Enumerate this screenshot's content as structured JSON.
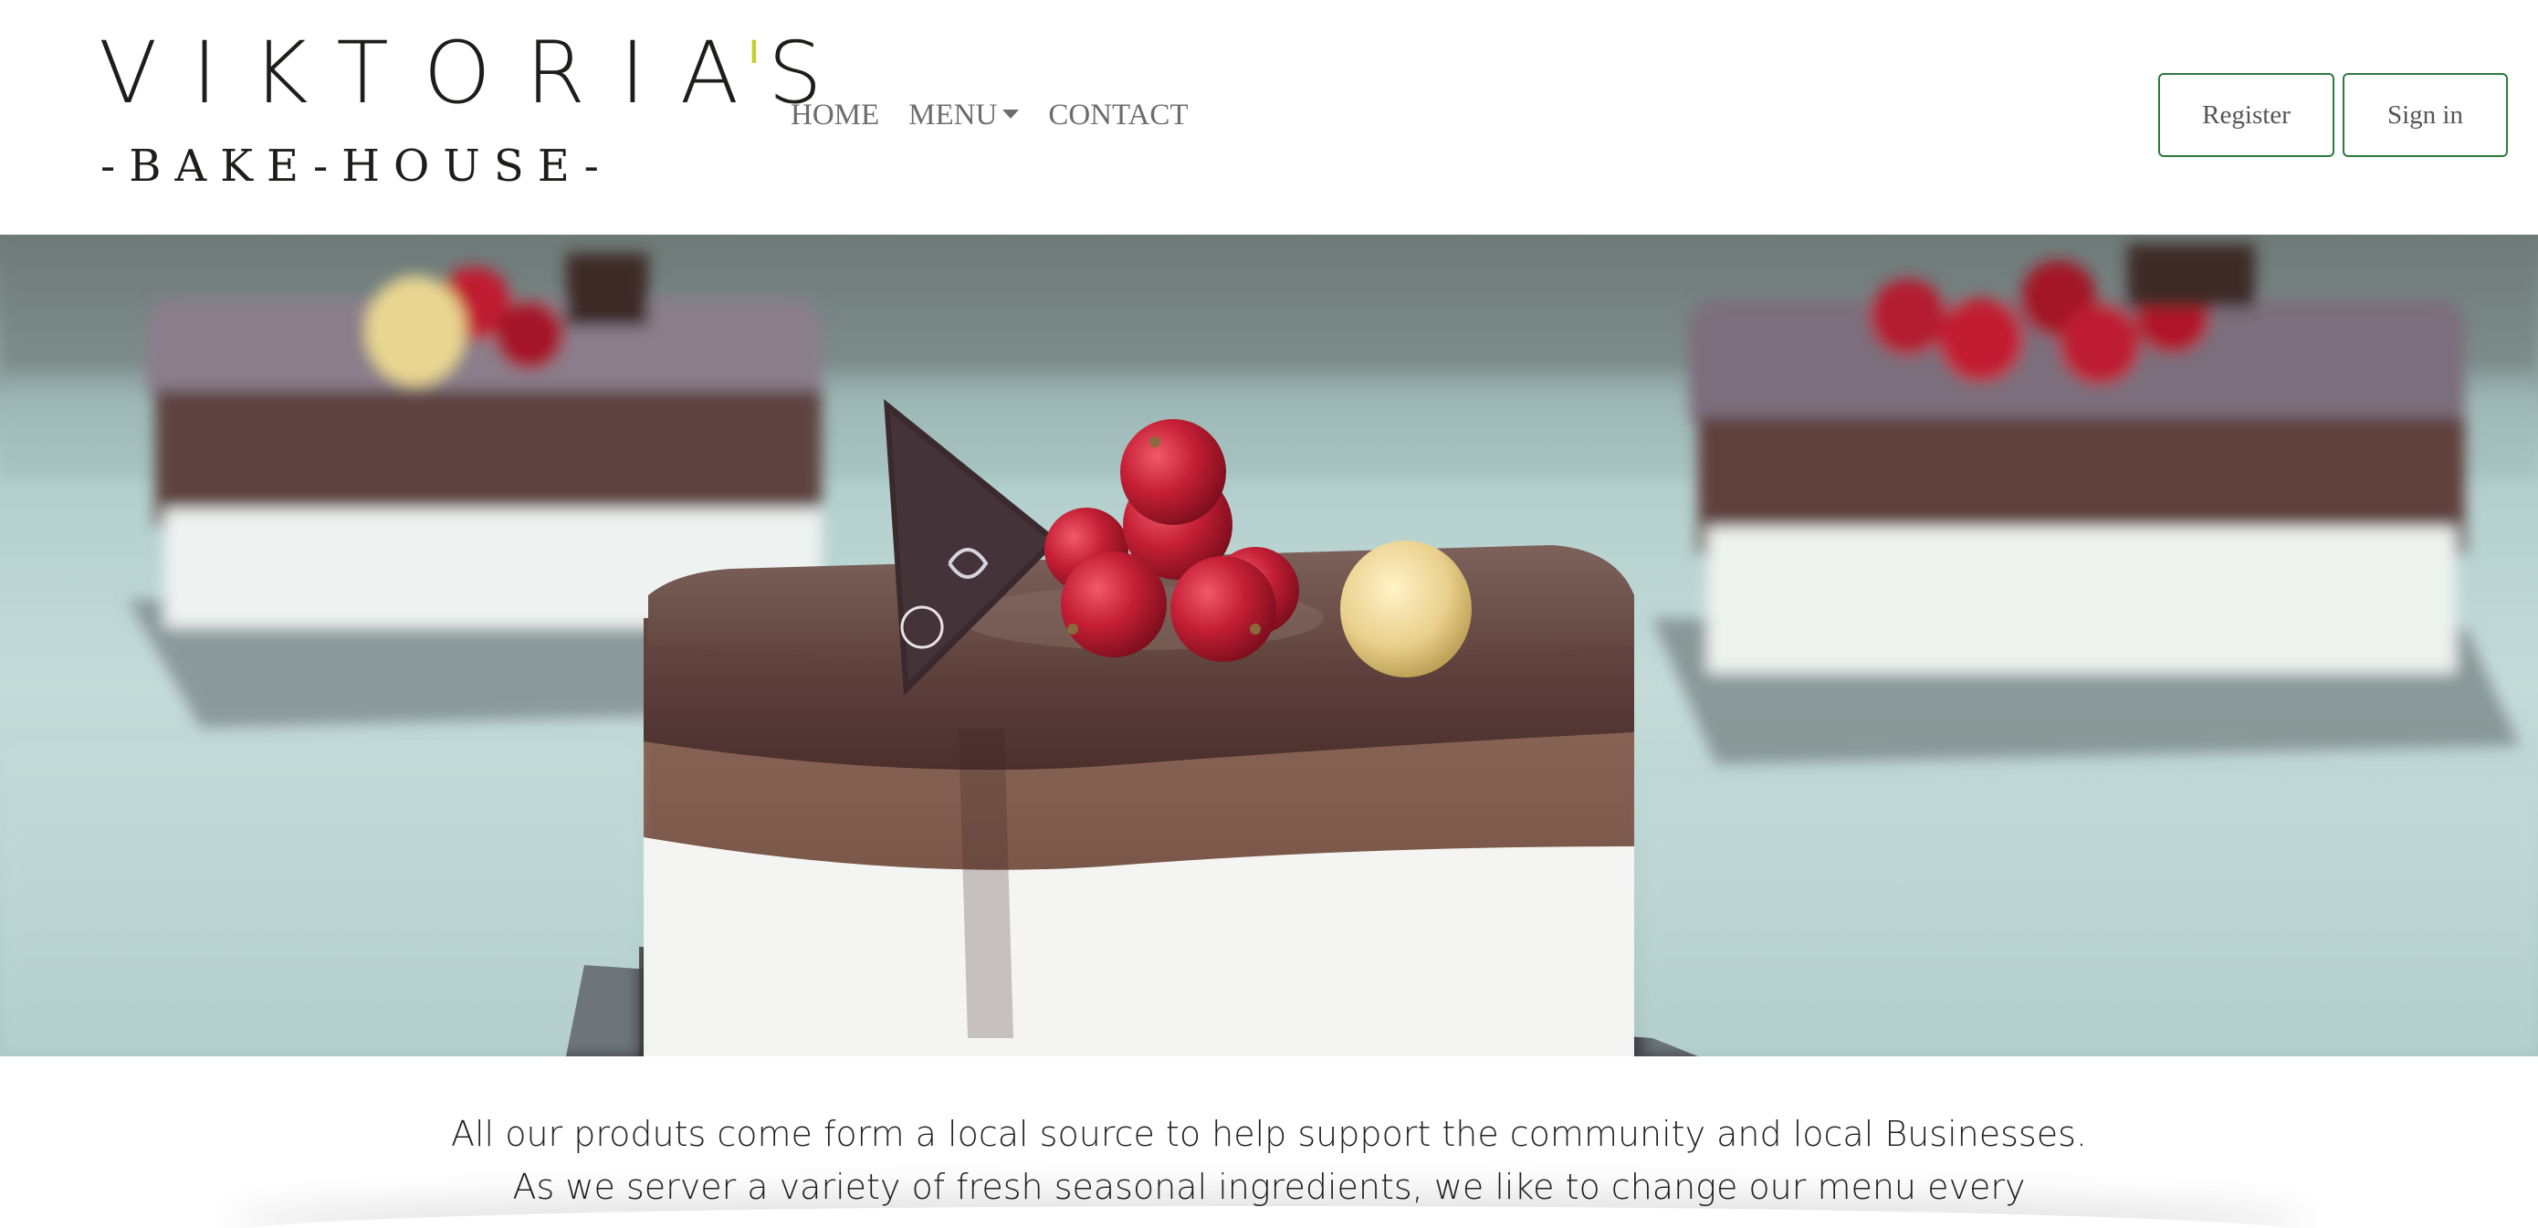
{
  "brand": {
    "name_main": "VIKTORIA",
    "name_apostrophe": "'",
    "name_end": "S",
    "tagline": "-BAKE-HOUSE-",
    "accent_color": "#c3cf2a"
  },
  "nav": {
    "items": [
      {
        "label": "HOME"
      },
      {
        "label": "MENU",
        "has_dropdown": true
      },
      {
        "label": "CONTACT"
      }
    ]
  },
  "auth": {
    "register_label": "Register",
    "signin_label": "Sign in",
    "button_border_color": "#2c7a3f"
  },
  "hero": {
    "image": "chocolate-mousse-cakes-photo"
  },
  "intro": {
    "line1": "All our produts come form a local source to help support the community and local Businesses.",
    "line2": "As we server a variety of fresh seasonal ingredients, we like to change our menu every"
  }
}
